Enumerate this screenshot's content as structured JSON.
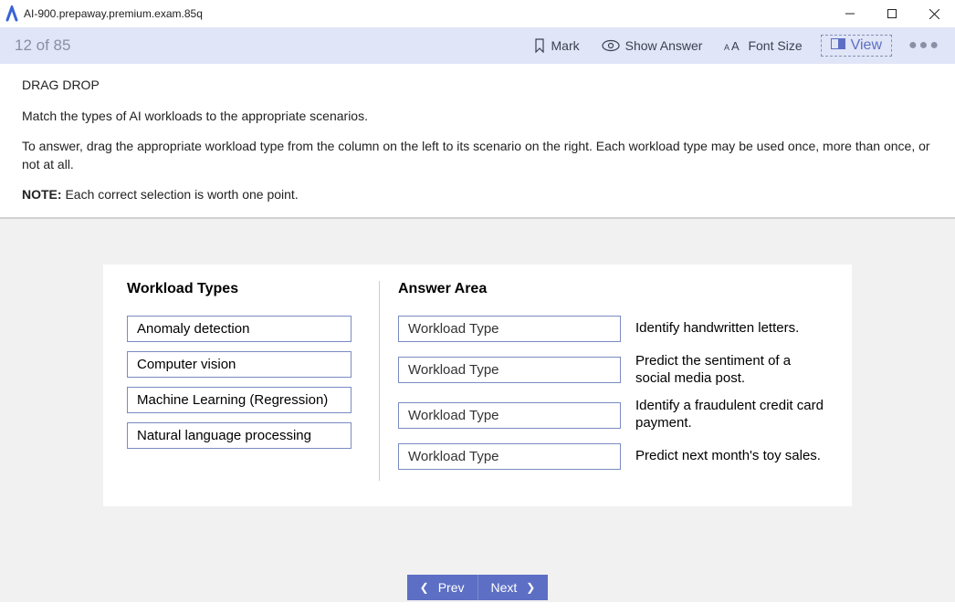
{
  "window": {
    "title": "AI-900.prepaway.premium.exam.85q"
  },
  "toolbar": {
    "counter": "12 of 85",
    "mark": "Mark",
    "show_answer": "Show Answer",
    "font_size": "Font Size",
    "view": "View"
  },
  "question": {
    "heading": "DRAG DROP",
    "line1": "Match the types of AI workloads to the appropriate scenarios.",
    "line2": "To answer, drag the appropriate workload type from the column on the left to its scenario on the right. Each workload type may be used once, more than once, or not at all.",
    "note_label": "NOTE:",
    "note_text": " Each correct selection is worth one point."
  },
  "drag": {
    "source_header": "Workload Types",
    "target_header": "Answer Area",
    "sources": [
      "Anomaly detection",
      "Computer vision",
      "Machine Learning (Regression)",
      "Natural language processing"
    ],
    "targets": [
      {
        "placeholder": "Workload Type",
        "scenario": "Identify handwritten letters."
      },
      {
        "placeholder": "Workload Type",
        "scenario": "Predict the sentiment of a social media post."
      },
      {
        "placeholder": "Workload Type",
        "scenario": "Identify a fraudulent credit card payment."
      },
      {
        "placeholder": "Workload Type",
        "scenario": "Predict next month's toy sales."
      }
    ]
  },
  "nav": {
    "prev": "Prev",
    "next": "Next"
  }
}
